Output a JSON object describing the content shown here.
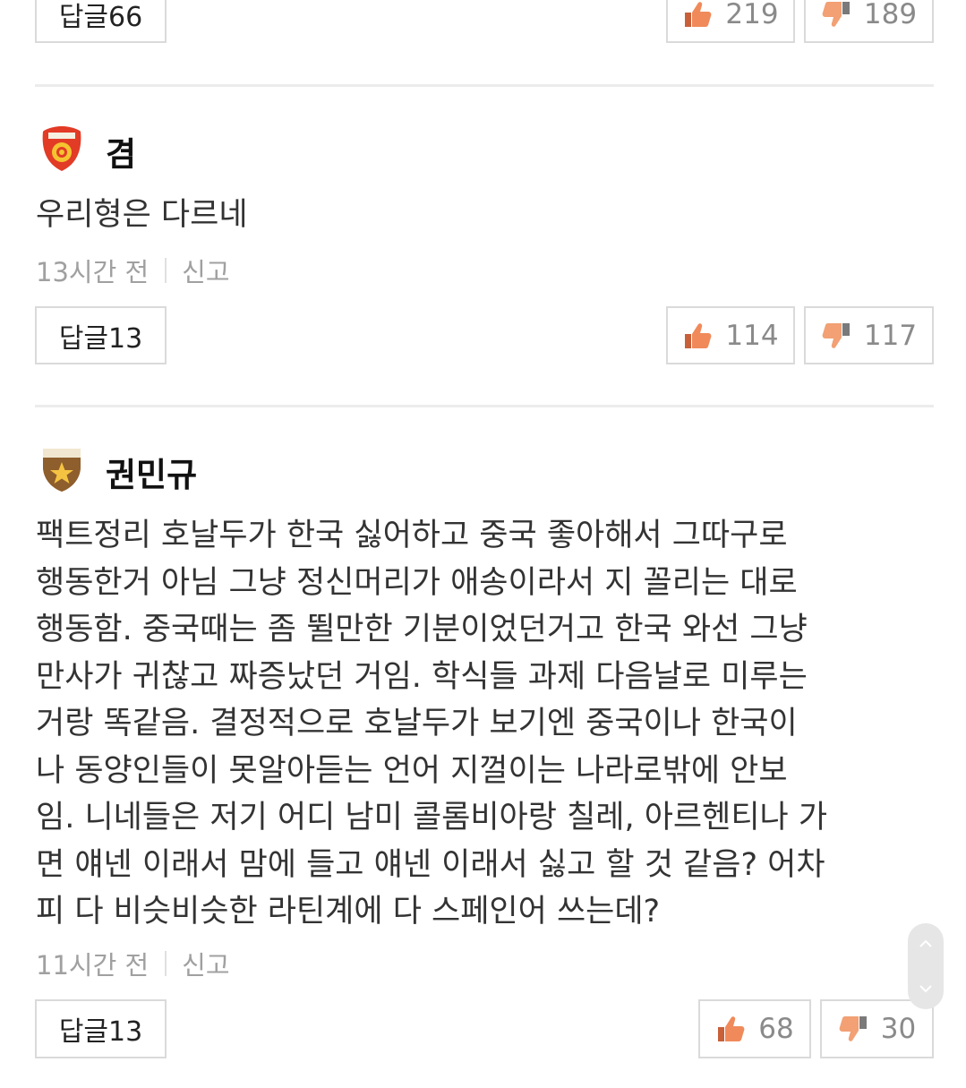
{
  "comments": [
    {
      "reply_label": "답글66",
      "likes": "219",
      "dislikes": "189"
    },
    {
      "username": "겸",
      "badge": "seal-badge-icon",
      "text": "우리형은 다르네",
      "time": "13시간 전",
      "report_label": "신고",
      "reply_label": "답글13",
      "likes": "114",
      "dislikes": "117"
    },
    {
      "username": "권민규",
      "badge": "star-badge-icon",
      "text": "팩트정리 호날두가 한국 싫어하고 중국 좋아해서 그따구로\n행동한거 아님 그냥 정신머리가 애송이라서 지 꼴리는 대로\n행동함. 중국때는 좀 뛸만한 기분이었던거고 한국 와선 그냥\n만사가 귀찮고 짜증났던 거임. 학식들 과제 다음날로 미루는\n거랑 똑같음. 결정적으로 호날두가 보기엔 중국이나 한국이\n나 동양인들이 못알아듣는 언어 지껄이는 나라로밖에 안보\n임. 니네들은 저기 어디 남미 콜롬비아랑 칠레, 아르헨티나 가\n면 얘넨 이래서 맘에 들고 얘넨 이래서 싫고 할 것 같음? 어차\n피 다 비슷비슷한 라틴계에 다 스페인어 쓰는데?",
      "time": "11시간 전",
      "report_label": "신고",
      "reply_label": "답글13",
      "likes": "68",
      "dislikes": "30"
    }
  ],
  "colors": {
    "like_hand": "#f08a5a",
    "dislike_hand": "#f2a074",
    "border": "#dadada",
    "muted_text": "#a0a0a0"
  },
  "icons": {
    "like": "thumbs-up-icon",
    "dislike": "thumbs-down-icon",
    "scroll_up": "chevron-up-icon",
    "scroll_down": "chevron-down-icon"
  }
}
